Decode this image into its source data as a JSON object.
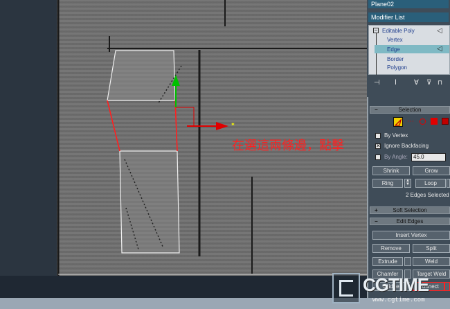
{
  "viewport": {
    "annotation_text": "在選這兩條邊，點擊"
  },
  "panel": {
    "object_name": "Plane02",
    "modifier_list_label": "Modifier List",
    "stack": {
      "root": "Editable Poly",
      "items": [
        "Vertex",
        "Edge",
        "Border",
        "Polygon"
      ],
      "selected_item": "Edge"
    },
    "selection": {
      "header": "Selection",
      "by_vertex": "By Vertex",
      "by_vertex_checked": false,
      "ignore_backfacing": "Ignore Backfacing",
      "ignore_backfacing_checked": true,
      "by_angle": "By Angle:",
      "by_angle_checked": false,
      "angle_value": "45.0",
      "shrink": "Shrink",
      "grow": "Grow",
      "ring": "Ring",
      "loop": "Loop",
      "status": "2 Edges Selected"
    },
    "soft_selection": {
      "header": "Soft Selection"
    },
    "edit_edges": {
      "header": "Edit Edges",
      "insert_vertex": "Insert Vertex",
      "remove": "Remove",
      "split": "Split",
      "extrude": "Extrude",
      "weld": "Weld",
      "chamfer": "Chamfer",
      "target_weld": "Target Weld",
      "bridge": "Bridge",
      "connect": "Connect"
    }
  },
  "watermark": {
    "brand": "CGTIME",
    "url": "www.cgtime.com"
  },
  "colors": {
    "viewport_bg": "#6f6f6f",
    "panel_bg": "#3f4c58",
    "stack_bg": "#d9dde2",
    "stack_highlight": "#7fb9c4",
    "annotation_red": "#ff2020",
    "gizmo_green": "#00c000",
    "gizmo_red": "#e00000"
  }
}
